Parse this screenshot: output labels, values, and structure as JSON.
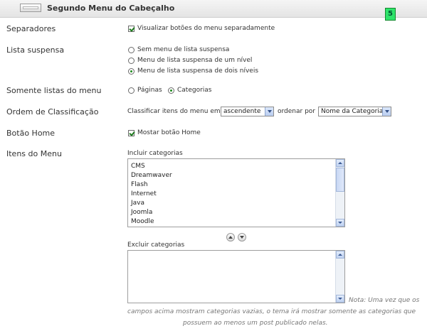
{
  "header": {
    "title": "Segundo Menu do Cabeçalho",
    "badge": "5"
  },
  "separadores": {
    "label": "Separadores",
    "checkbox_label": "Visualizar botões do menu separadamente",
    "checked": true
  },
  "lista_suspensa": {
    "label": "Lista suspensa",
    "options": [
      "Sem menu de lista suspensa",
      "Menu de lista suspensa de um nível",
      "Menu de lista suspensa de dois níveis"
    ],
    "selected": "Menu de lista suspensa de dois níveis"
  },
  "somente_listas": {
    "label": "Somente listas do menu",
    "options": [
      "Páginas",
      "Categorias"
    ],
    "selected": "Categorias"
  },
  "ordem": {
    "label": "Ordem de Classificação",
    "prefix": "Classificar itens do menu em",
    "order_value": "ascendente",
    "middle": "ordenar por",
    "sort_value": "Nome da Categoria"
  },
  "botao_home": {
    "label": "Botão Home",
    "checkbox_label": "Mostar botão Home",
    "checked": true
  },
  "itens": {
    "label": "Itens do Menu",
    "include_label": "Incluir categorias",
    "include_items": [
      "CMS",
      "Dreamwaver",
      "Flash",
      "Internet",
      "Java",
      "Joomla",
      "Moodle"
    ],
    "exclude_label": "Excluir categorias",
    "exclude_items": []
  },
  "note": {
    "line1": "Nota: Uma vez que os",
    "line2": "campos acima mostram categorias vazias, o tema irá mostrar somente as categorias que",
    "line3": "possuem ao menos um post publicado nelas."
  }
}
